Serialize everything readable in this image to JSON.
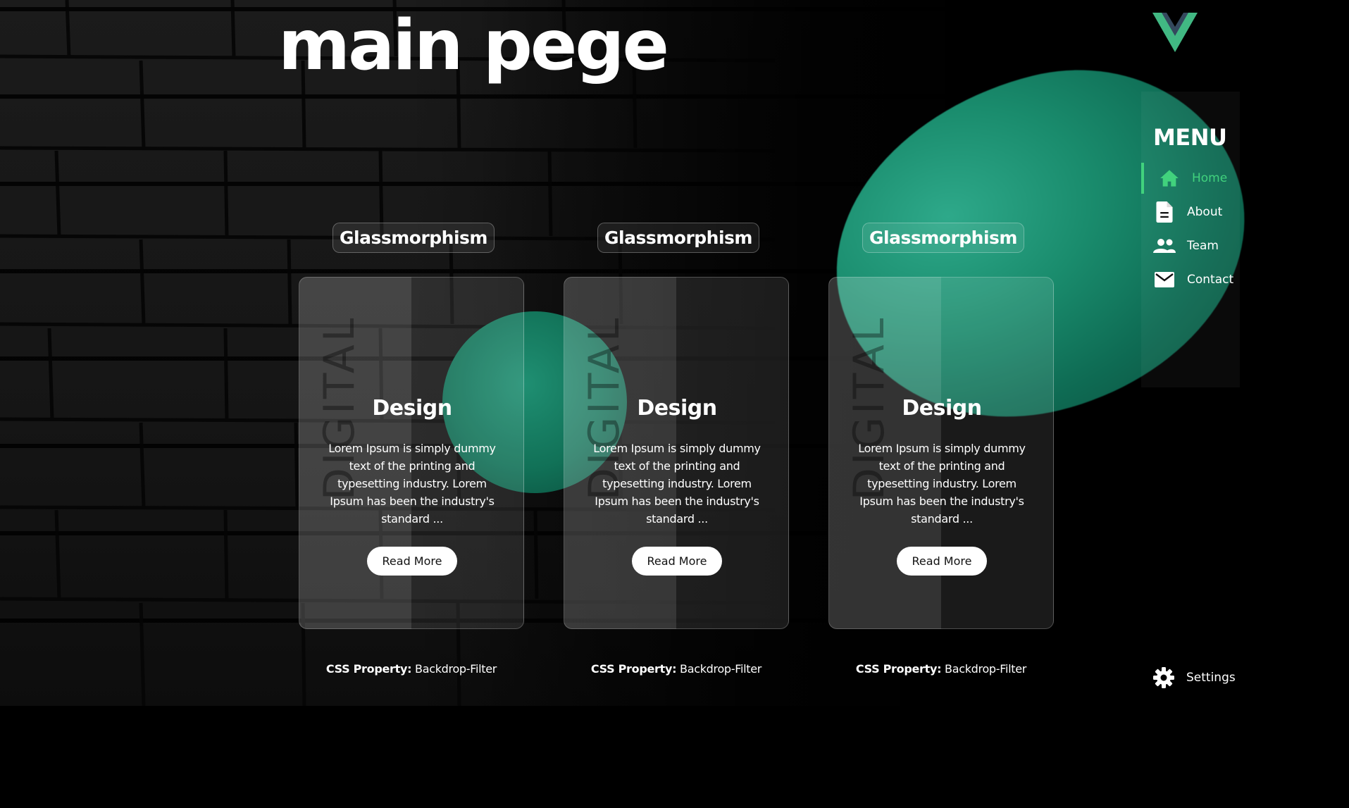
{
  "page": {
    "title": "main pege"
  },
  "menu": {
    "title": "MENU",
    "items": [
      {
        "label": "Home",
        "icon": "home-icon",
        "active": true
      },
      {
        "label": "About",
        "icon": "document-icon",
        "active": false
      },
      {
        "label": "Team",
        "icon": "team-icon",
        "active": false
      },
      {
        "label": "Contact",
        "icon": "mail-icon",
        "active": false
      }
    ],
    "settings_label": "Settings"
  },
  "cards": [
    {
      "badge": "Glassmorphism",
      "watermark": "DIGITAL",
      "heading": "Design",
      "text": "Lorem Ipsum is simply dummy text of the printing and typesetting industry. Lorem Ipsum has been the industry's standard ...",
      "button": "Read More",
      "caption_key": "CSS Property:",
      "caption_value": "Backdrop-Filter"
    },
    {
      "badge": "Glassmorphism",
      "watermark": "DIGITAL",
      "heading": "Design",
      "text": "Lorem Ipsum is simply dummy text of the printing and typesetting industry. Lorem Ipsum has been the industry's standard ...",
      "button": "Read More",
      "caption_key": "CSS Property:",
      "caption_value": "Backdrop-Filter"
    },
    {
      "badge": "Glassmorphism",
      "watermark": "DIGITAL",
      "heading": "Design",
      "text": "Lorem Ipsum is simply dummy text of the printing and typesetting industry. Lorem Ipsum has been the industry's standard ...",
      "button": "Read More",
      "caption_key": "CSS Property:",
      "caption_value": "Backdrop-Filter"
    }
  ],
  "colors": {
    "accent": "#41d27d",
    "blob": "#1a8c6d",
    "logo_outer": "#41b883",
    "logo_inner": "#34495e"
  }
}
